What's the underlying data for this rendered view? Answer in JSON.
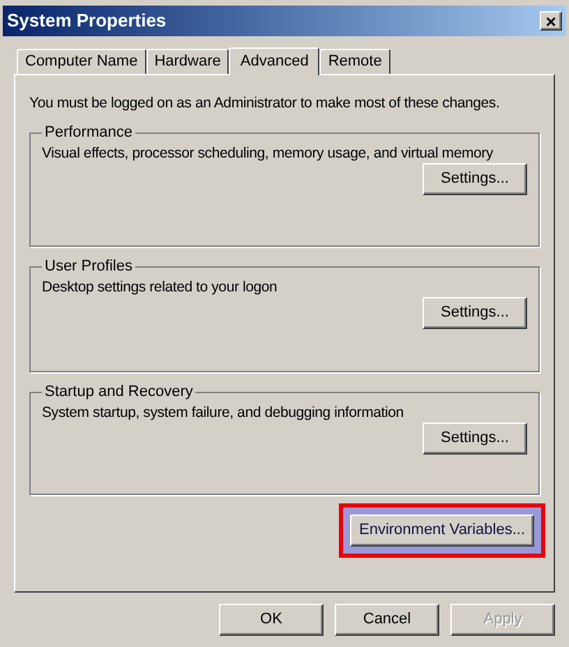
{
  "window": {
    "title": "System Properties",
    "close": "×"
  },
  "tabs": [
    {
      "label": "Computer Name",
      "selected": false
    },
    {
      "label": "Hardware",
      "selected": false
    },
    {
      "label": "Advanced",
      "selected": true
    },
    {
      "label": "Remote",
      "selected": false
    }
  ],
  "notice": "You must be logged on as an Administrator to make most of these changes.",
  "groups": [
    {
      "title": "Performance",
      "description": "Visual effects, processor scheduling, memory usage, and virtual memory",
      "button": "Settings..."
    },
    {
      "title": "User Profiles",
      "description": "Desktop settings related to your logon",
      "button": "Settings..."
    },
    {
      "title": "Startup and Recovery",
      "description": "System startup, system failure, and debugging information",
      "button": "Settings..."
    }
  ],
  "environment_button": {
    "label": "Environment Variables...",
    "highlighted": true
  },
  "buttons": [
    {
      "label": "OK",
      "disabled": false
    },
    {
      "label": "Cancel",
      "disabled": false
    },
    {
      "label": "Apply",
      "disabled": true
    }
  ]
}
